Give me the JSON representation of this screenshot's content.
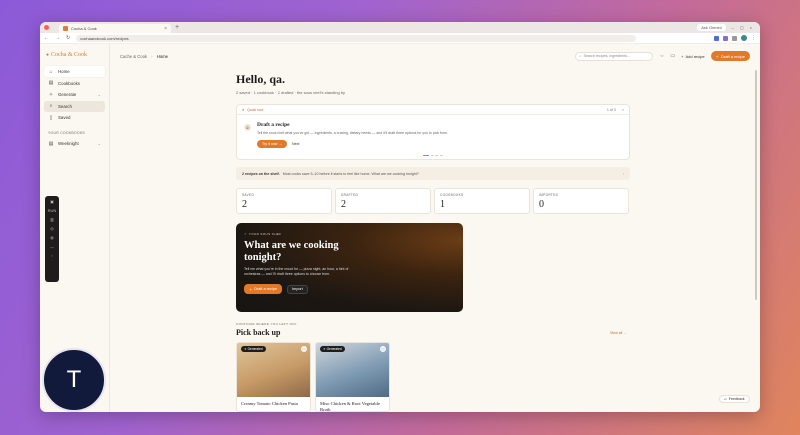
{
  "browser": {
    "tab_title": "Cocha & Cook",
    "tab_close": "×",
    "new_tab": "+",
    "ask_gemini": "Ask Gemini",
    "url": "cochaandcook.com/recipes",
    "win_min": "–",
    "win_max": "▢",
    "win_close": "×"
  },
  "sidebar": {
    "brand": "Cocha & Cook",
    "items": [
      {
        "label": "Home",
        "icon": "⌂"
      },
      {
        "label": "Cookbooks",
        "icon": "▤"
      },
      {
        "label": "Generate",
        "icon": "✧",
        "chev": "⌄"
      },
      {
        "label": "Search",
        "icon": "⌕"
      },
      {
        "label": "Saved",
        "icon": "▯"
      }
    ],
    "section_label": "YOUR COOKBOOKS",
    "cookbooks": [
      {
        "label": "Weeknight",
        "icon": "▤",
        "chev": "⌄"
      }
    ],
    "toolstrip": [
      "▣",
      "RUN",
      "▥",
      "◎",
      "◍",
      "—",
      "◌"
    ],
    "avatar_letter": "T"
  },
  "header": {
    "crumb_root": "Cache & Cook",
    "crumb_sep": "›",
    "crumb_current": "Home",
    "search_placeholder": "Search recipes, ingredients...",
    "add_recipe": "Add recipe",
    "draft_recipe": "Draft a recipe"
  },
  "main": {
    "greeting": "Hello, qa.",
    "subline": "2 saved · 1 cookbook · 2 drafted · the sous chef's standing by",
    "quick": {
      "label": "Quick tour",
      "counter": "1 of 3",
      "close": "×",
      "title": "Draft a recipe",
      "desc": "Tell the sous chef what you've got — ingredients, a craving, dietary needs — and it'll draft three options for you to pick from.",
      "try_label": "Try it now",
      "next_label": "Next"
    },
    "onshelf": {
      "bold": "2 recipes on the shelf.",
      "text": "Most cooks save 5–10 before it starts to feel like home. What are we cooking tonight?"
    },
    "stats": [
      {
        "label": "SAVED",
        "value": "2"
      },
      {
        "label": "DRAFTED",
        "value": "2"
      },
      {
        "label": "COOKBOOKS",
        "value": "1"
      },
      {
        "label": "IMPORTED",
        "value": "0"
      }
    ],
    "hero": {
      "kicker": "YOUR SOUS CHEF",
      "title": "What are we cooking tonight?",
      "desc": "Tell me what you're in the mood for — pizza night, an hour, a hint of orchestras — and I'll draft three options to choose from.",
      "draft_label": "Draft a recipe",
      "import_label": "Import"
    },
    "pickback": {
      "kicker": "CONTINUE WHERE YOU LEFT OFF",
      "title": "Pick back up",
      "view_all": "View all →"
    },
    "cards": [
      {
        "badge": "Generated",
        "title": "Creamy Tomato Chicken Pasta"
      },
      {
        "badge": "Generated",
        "title": "Miso Chicken & Root Vegetable Broth"
      }
    ],
    "feedback": "Feedback"
  },
  "colors": {
    "accent": "#e07a2a",
    "card_img_1": "#c79a66",
    "card_img_2": "#7f9ab3"
  }
}
